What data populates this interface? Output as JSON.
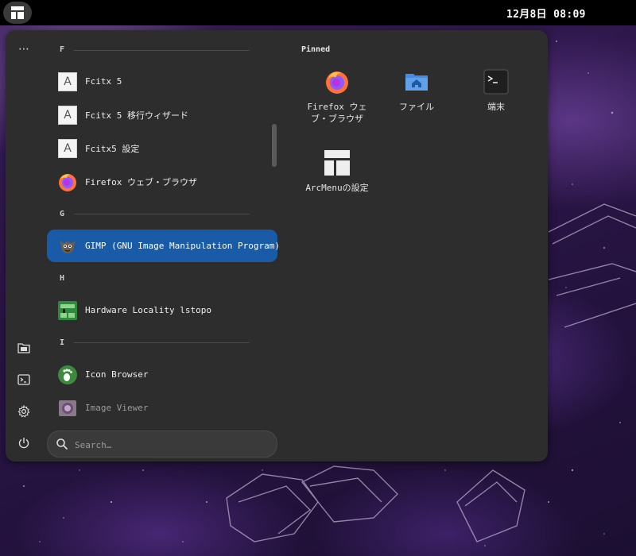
{
  "top_bar": {
    "clock": "12月8日 08:09",
    "menu_icon": "arcmenu-layout-icon"
  },
  "menu": {
    "rail": {
      "more_glyph": "⋯",
      "icons": [
        "more-icon",
        "files-icon",
        "terminal-icon",
        "settings-icon",
        "power-icon"
      ]
    },
    "sections": [
      {
        "letter": "F",
        "apps": [
          {
            "label": "Fcitx 5",
            "icon": "fcitx-icon",
            "icon_letter": "A"
          },
          {
            "label": "Fcitx 5 移行ウィザード",
            "icon": "fcitx-icon",
            "icon_letter": "A"
          },
          {
            "label": "Fcitx5 設定",
            "icon": "fcitx-icon",
            "icon_letter": "A"
          },
          {
            "label": "Firefox ウェブ・ブラウザ",
            "icon": "firefox-icon"
          }
        ]
      },
      {
        "letter": "G",
        "apps": [
          {
            "label": "GIMP (GNU Image Manipulation Program)",
            "icon": "gimp-icon",
            "selected": true
          }
        ]
      },
      {
        "letter": "H",
        "apps": [
          {
            "label": "Hardware Locality lstopo",
            "icon": "lstopo-icon"
          }
        ]
      },
      {
        "letter": "I",
        "apps": [
          {
            "label": "Icon Browser",
            "icon": "gnome-foot-icon"
          },
          {
            "label": "Image Viewer",
            "icon": "image-viewer-icon"
          }
        ]
      }
    ],
    "search": {
      "placeholder": "Search…"
    },
    "pinned": {
      "title": "Pinned",
      "items": [
        {
          "label": "Firefox ウェブ・ブラウザ",
          "icon": "firefox-icon"
        },
        {
          "label": "ファイル",
          "icon": "folder-home-icon"
        },
        {
          "label": "端末",
          "icon": "terminal-icon"
        },
        {
          "label": "ArcMenuの設定",
          "icon": "arcmenu-layout-icon"
        }
      ]
    }
  },
  "colors": {
    "selected": "#1a5ba8",
    "panel": "#2d2d2d",
    "top_bar": "#000000"
  }
}
